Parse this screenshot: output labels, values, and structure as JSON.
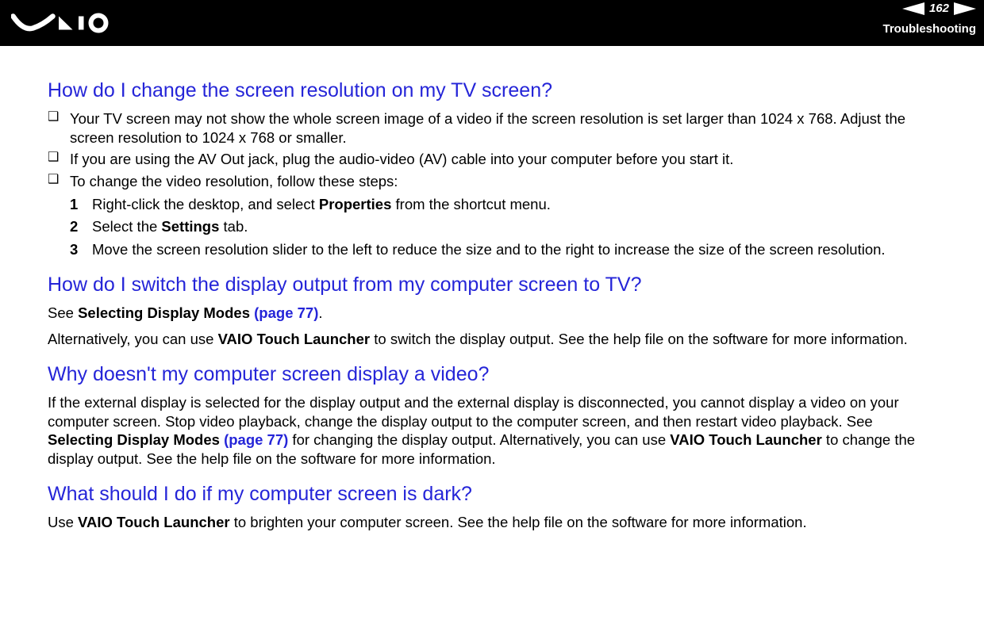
{
  "header": {
    "page_number": "162",
    "section": "Troubleshooting"
  },
  "q1": {
    "title": "How do I change the screen resolution on my TV screen?",
    "b1": "Your TV screen may not show the whole screen image of a video if the screen resolution is set larger than 1024 x 768. Adjust the screen resolution to 1024 x 768 or smaller.",
    "b2": "If you are using the AV Out jack, plug the audio-video (AV) cable into your computer before you start it.",
    "b3": "To change the video resolution, follow these steps:",
    "s1a": "Right-click the desktop, and select ",
    "s1b": "Properties",
    "s1c": " from the shortcut menu.",
    "s2a": "Select the ",
    "s2b": "Settings",
    "s2c": " tab.",
    "s3": "Move the screen resolution slider to the left to reduce the size and to the right to increase the size of the screen resolution."
  },
  "q2": {
    "title": "How do I switch the display output from my computer screen to TV?",
    "p1a": "See ",
    "p1b": "Selecting Display Modes ",
    "p1c": "(page 77)",
    "p1d": ".",
    "p2a": "Alternatively, you can use ",
    "p2b": "VAIO Touch Launcher",
    "p2c": " to switch the display output. See the help file on the software for more information."
  },
  "q3": {
    "title": "Why doesn't my computer screen display a video?",
    "p1a": "If the external display is selected for the display output and the external display is disconnected, you cannot display a video on your computer screen. Stop video playback, change the display output to the computer screen, and then restart video playback. See ",
    "p1b": "Selecting Display Modes ",
    "p1c": "(page 77)",
    "p1d": " for changing the display output. Alternatively, you can use ",
    "p1e": "VAIO Touch Launcher",
    "p1f": " to change the display output. See the help file on the software for more information."
  },
  "q4": {
    "title": "What should I do if my computer screen is dark?",
    "p1a": "Use ",
    "p1b": "VAIO Touch Launcher",
    "p1c": " to brighten your computer screen. See the help file on the software for more information."
  }
}
